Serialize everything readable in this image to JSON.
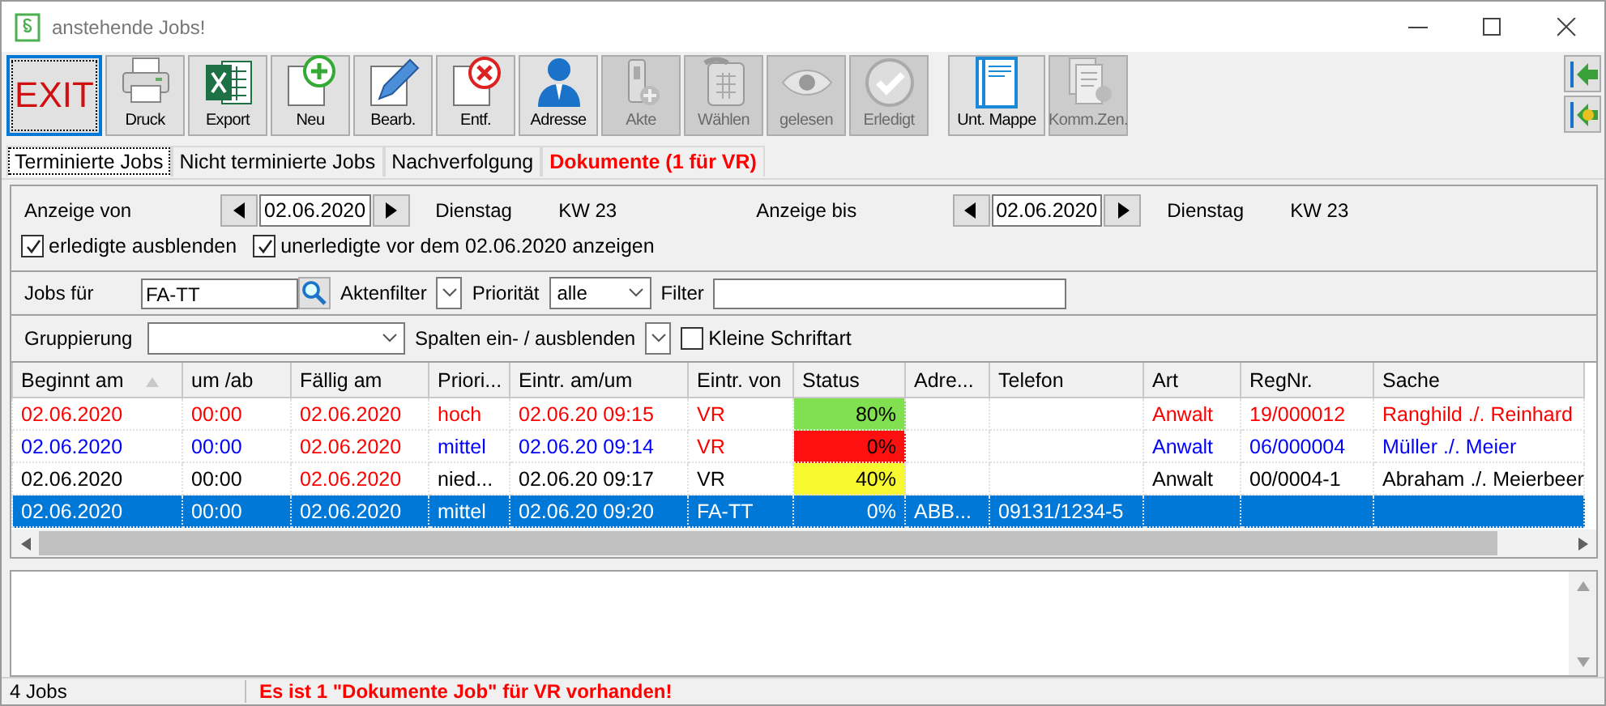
{
  "window": {
    "title": "anstehende Jobs!"
  },
  "toolbar": [
    {
      "label": "EXIT",
      "kind": "exit",
      "disabled": false,
      "focused": true
    },
    {
      "label": "Druck",
      "kind": "printer",
      "disabled": false,
      "focused": false
    },
    {
      "label": "Export",
      "kind": "excel",
      "disabled": false,
      "focused": false
    },
    {
      "label": "Neu",
      "kind": "new",
      "disabled": false,
      "focused": false
    },
    {
      "label": "Bearb.",
      "kind": "edit",
      "disabled": false,
      "focused": false
    },
    {
      "label": "Entf.",
      "kind": "delete",
      "disabled": false,
      "focused": false
    },
    {
      "label": "Adresse",
      "kind": "person",
      "disabled": false,
      "focused": false
    },
    {
      "label": "Akte",
      "kind": "file",
      "disabled": true,
      "focused": false
    },
    {
      "label": "Wählen",
      "kind": "phone",
      "disabled": true,
      "focused": false
    },
    {
      "label": "gelesen",
      "kind": "eye",
      "disabled": true,
      "focused": false
    },
    {
      "label": "Erledigt",
      "kind": "check",
      "disabled": true,
      "focused": false
    },
    {
      "label": "Unt. Mappe",
      "kind": "folder",
      "disabled": false,
      "focused": false,
      "group_start": true
    },
    {
      "label": "Komm.Zen.",
      "kind": "docs",
      "disabled": true,
      "focused": false
    }
  ],
  "side_buttons": [
    {
      "kind": "arrow"
    },
    {
      "kind": "arrow-x"
    }
  ],
  "tabs": [
    {
      "label": "Terminierte Jobs",
      "selected": true,
      "alert": false
    },
    {
      "label": "Nicht terminierte Jobs",
      "selected": false,
      "alert": false
    },
    {
      "label": "Nachverfolgung",
      "selected": false,
      "alert": false
    },
    {
      "label": "Dokumente (1 für VR)",
      "selected": false,
      "alert": true
    }
  ],
  "filters": {
    "from": {
      "label": "Anzeige von",
      "date": "02.06.2020",
      "weekday": "Dienstag",
      "week": "KW 23"
    },
    "to": {
      "label": "Anzeige bis",
      "date": "02.06.2020",
      "weekday": "Dienstag",
      "week": "KW 23"
    },
    "checkboxes": [
      {
        "label": "erledigte ausblenden",
        "checked": true
      },
      {
        "label": "unerledigte vor dem 02.06.2020 anzeigen",
        "checked": true
      }
    ],
    "jobs_for": {
      "label": "Jobs für",
      "value": "FA-TT"
    },
    "file_filter": {
      "label": "Aktenfilter"
    },
    "priority": {
      "label": "Priorität",
      "value": "alle"
    },
    "filter": {
      "label": "Filter"
    },
    "grouping": {
      "label": "Gruppierung"
    },
    "columns_toggle": {
      "label": "Spalten ein- / ausblenden"
    },
    "small_font": {
      "label": "Kleine Schriftart",
      "checked": false
    }
  },
  "table": {
    "columns": [
      {
        "label": "Beginnt am",
        "sort_ascending": true
      },
      {
        "label": "um /ab"
      },
      {
        "label": "Fällig am"
      },
      {
        "label": "Priori..."
      },
      {
        "label": "Eintr. am/um"
      },
      {
        "label": "Eintr. von"
      },
      {
        "label": "Status"
      },
      {
        "label": "Adre..."
      },
      {
        "label": "Telefon"
      },
      {
        "label": "Art"
      },
      {
        "label": "RegNr."
      },
      {
        "label": "Sache"
      }
    ],
    "rows": [
      {
        "selected": false,
        "cells": [
          {
            "text": "02.06.2020",
            "color": "#ff0000"
          },
          {
            "text": "00:00",
            "color": "#ff0000"
          },
          {
            "text": "02.06.2020",
            "color": "#ff0000"
          },
          {
            "text": "hoch",
            "color": "#ff0000"
          },
          {
            "text": "02.06.20 09:15",
            "color": "#ff0000"
          },
          {
            "text": "VR",
            "color": "#ff0000"
          },
          {
            "text": "80%",
            "kind": "status",
            "color": "#80e050"
          },
          {},
          {},
          {
            "text": "Anwalt",
            "color": "#ff0000"
          },
          {
            "text": "19/000012",
            "color": "#ff0000"
          },
          {
            "text": "Ranghild ./. Reinhard",
            "color": "#ff0000"
          }
        ]
      },
      {
        "selected": false,
        "cells": [
          {
            "text": "02.06.2020",
            "color": "#0000ff"
          },
          {
            "text": "00:00",
            "color": "#0000ff"
          },
          {
            "text": "02.06.2020",
            "color": "#ff0000"
          },
          {
            "text": "mittel",
            "color": "#0000ff"
          },
          {
            "text": "02.06.20 09:14",
            "color": "#0000ff"
          },
          {
            "text": "VR",
            "color": "#ff0000"
          },
          {
            "text": "0%",
            "kind": "status",
            "color": "#ff1010"
          },
          {},
          {},
          {
            "text": "Anwalt",
            "color": "#0000ff"
          },
          {
            "text": "06/000004",
            "color": "#0000ff"
          },
          {
            "text": "Müller ./. Meier",
            "color": "#0000ff"
          }
        ]
      },
      {
        "selected": false,
        "cells": [
          {
            "text": "02.06.2020",
            "color": "#000000"
          },
          {
            "text": "00:00",
            "color": "#000000"
          },
          {
            "text": "02.06.2020",
            "color": "#ff0000"
          },
          {
            "text": "nied...",
            "color": "#000000"
          },
          {
            "text": "02.06.20 09:17",
            "color": "#000000"
          },
          {
            "text": "VR",
            "color": "#000000"
          },
          {
            "text": "40%",
            "kind": "status",
            "color": "#f8f830"
          },
          {},
          {},
          {
            "text": "Anwalt",
            "color": "#000000"
          },
          {
            "text": "00/0004-1",
            "color": "#000000"
          },
          {
            "text": "Abraham ./. Meierbeer",
            "color": "#000000"
          }
        ]
      },
      {
        "selected": true,
        "cells": [
          {
            "text": "02.06.2020"
          },
          {
            "text": "00:00"
          },
          {
            "text": "02.06.2020"
          },
          {
            "text": "mittel"
          },
          {
            "text": "02.06.20 09:20"
          },
          {
            "text": "FA-TT"
          },
          {
            "text": "0%",
            "kind": "status"
          },
          {
            "text": "ABB..."
          },
          {
            "text": "09131/1234-5"
          },
          {},
          {},
          {}
        ]
      }
    ]
  },
  "status_bar": {
    "count": "4 Jobs",
    "message": "Es ist 1 \"Dokumente Job\" für VR vorhanden!"
  }
}
